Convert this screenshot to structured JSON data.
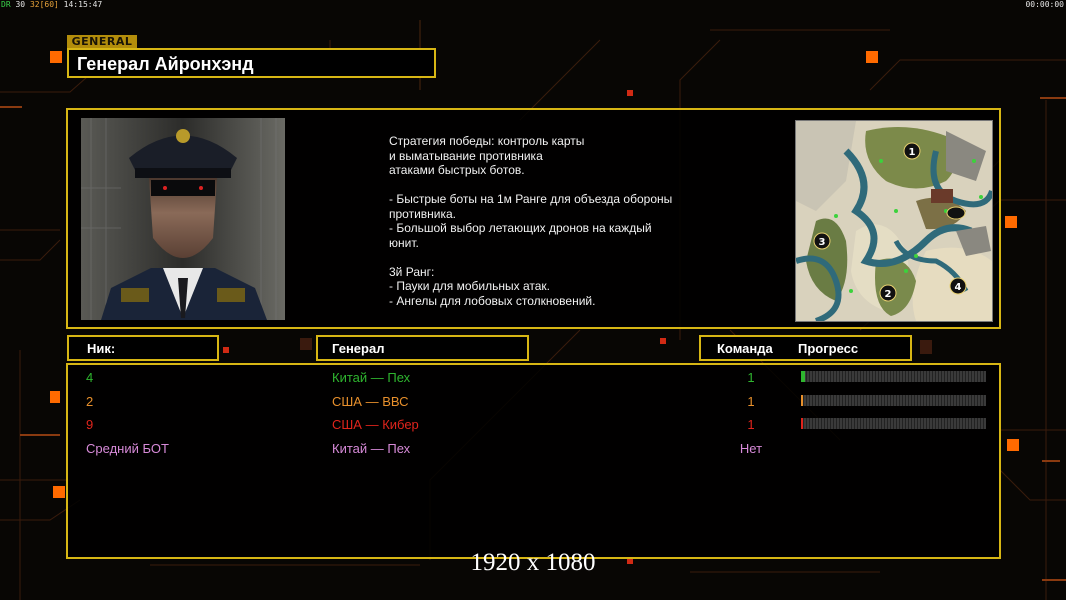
{
  "hud": {
    "build": "DR",
    "fps": "30",
    "fps_target": "32",
    "fps_limit": "[60]",
    "clock": "14:15:47",
    "timer": "00:00:00"
  },
  "general_tag": "GENERAL",
  "general_name": "Генерал Айронхэнд",
  "description": "Стратегия победы: контроль карты\nи выматывание противника\nатаками быстрых ботов.\n\n- Быстрые боты на 1м Ранге для объезда обороны\n противника.\n- Большой выбор летающих дронов на каждый\n юнит.\n\n3й Ранг:\n- Пауки для мобильных атак.\n- Ангелы для лобовых столкновений.",
  "minimap": {
    "spawn_labels": [
      "1",
      "2",
      "3",
      "4"
    ]
  },
  "columns": {
    "nick": "Ник:",
    "general": "Генерал",
    "team": "Команда",
    "progress": "Прогресс"
  },
  "players": [
    {
      "nick": "4",
      "general": "Китай — Пех",
      "team": "1",
      "color": "#2fb52f",
      "progress": 0.02,
      "show_progress": true
    },
    {
      "nick": "2",
      "general": "США — ВВС",
      "team": "1",
      "color": "#e8902c",
      "progress": 0.01,
      "show_progress": true
    },
    {
      "nick": "9",
      "general": "США — Кибер",
      "team": "1",
      "color": "#e0241c",
      "progress": 0.01,
      "show_progress": true
    },
    {
      "nick": "Средний БОТ",
      "general": "Китай — Пех",
      "team": "Нет",
      "color": "#d78ad8",
      "progress": 0,
      "show_progress": false
    }
  ],
  "resolution_label": "1920 x 1080",
  "colors": {
    "accent_yellow": "#d7b614",
    "accent_orange": "#ff6a00"
  }
}
